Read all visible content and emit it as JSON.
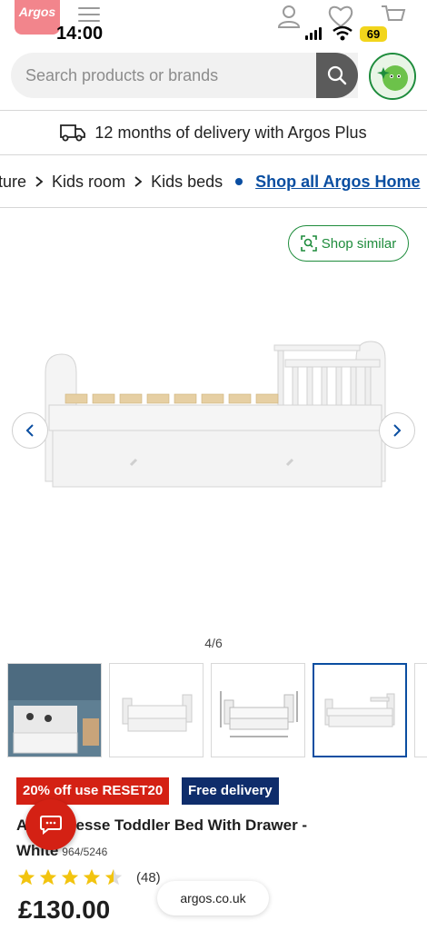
{
  "status_bar": {
    "time": "14:00",
    "battery": "69"
  },
  "header": {
    "logo_text": "Argos"
  },
  "search": {
    "placeholder": "Search products or brands",
    "value": ""
  },
  "delivery_banner": {
    "text": "12 months of delivery with Argos Plus"
  },
  "breadcrumb": {
    "items": [
      "ture",
      "Kids room",
      "Kids beds"
    ],
    "shop_all": "Shop all Argos Home"
  },
  "shop_similar": {
    "label": "Shop similar"
  },
  "gallery": {
    "counter": "4/6"
  },
  "badges": {
    "offer": "20% off use RESET20",
    "delivery": "Free delivery"
  },
  "product": {
    "title_line1": "A           ome Jesse Toddler Bed With Drawer -",
    "title_line2": "White",
    "catalogue_number": "964/5246",
    "rating": 4.5,
    "review_count": "(48)",
    "price": "£130.00"
  },
  "browser": {
    "url": "argos.co.uk"
  },
  "colors": {
    "brand_red": "#d42114",
    "link_blue": "#0a4ea1",
    "delivery_navy": "#0f2d6b",
    "accent_green": "#1e8c3c",
    "star_yellow": "#f2c40f"
  }
}
